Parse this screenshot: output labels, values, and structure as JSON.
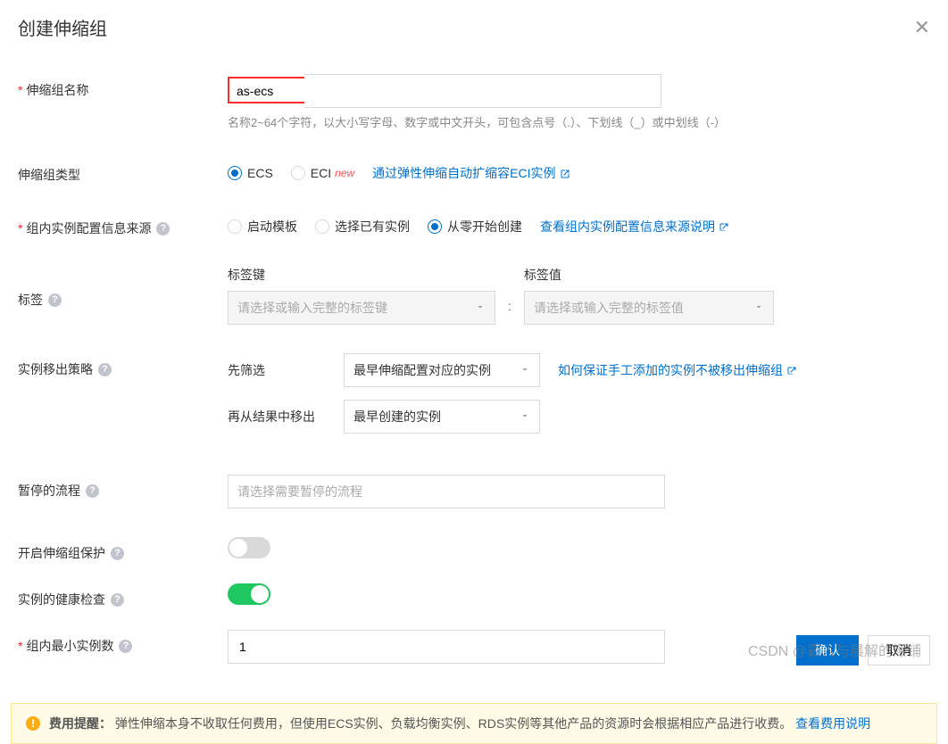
{
  "header": {
    "title": "创建伸缩组"
  },
  "form": {
    "name": {
      "label": "伸缩组名称",
      "value": "as-ecs",
      "hint": "名称2~64个字符，以大小写字母、数字或中文开头，可包含点号（.）、下划线（_）或中划线（-）"
    },
    "type": {
      "label": "伸缩组类型",
      "options": {
        "ecs": "ECS",
        "eci": "ECI"
      },
      "new_badge": "new",
      "link": "通过弹性伸缩自动扩缩容ECI实例"
    },
    "source": {
      "label": "组内实例配置信息来源",
      "options": {
        "template": "启动模板",
        "existing": "选择已有实例",
        "scratch": "从零开始创建"
      },
      "link": "查看组内实例配置信息来源说明"
    },
    "tags": {
      "label": "标签",
      "key_label": "标签键",
      "key_placeholder": "请选择或输入完整的标签键",
      "val_label": "标签值",
      "val_placeholder": "请选择或输入完整的标签值"
    },
    "removal": {
      "label": "实例移出策略",
      "first_label": "先筛选",
      "first_value": "最早伸缩配置对应的实例",
      "then_label": "再从结果中移出",
      "then_value": "最早创建的实例",
      "link": "如何保证手工添加的实例不被移出伸缩组"
    },
    "suspend": {
      "label": "暂停的流程",
      "placeholder": "请选择需要暂停的流程"
    },
    "protection": {
      "label": "开启伸缩组保护"
    },
    "health": {
      "label": "实例的健康检查"
    },
    "min": {
      "label": "组内最小实例数",
      "value": "1"
    }
  },
  "notice": {
    "prefix": "费用提醒：",
    "text": "弹性伸缩本身不收取任何费用，但使用ECS实例、负载均衡实例、RDS实例等其他产品的资源时会根据相应产品进行收费。",
    "link": "查看费用说明"
  },
  "footer": {
    "confirm": "确认",
    "cancel": "取消"
  },
  "watermark": "CSDN @霸人与晨解的爆铺"
}
